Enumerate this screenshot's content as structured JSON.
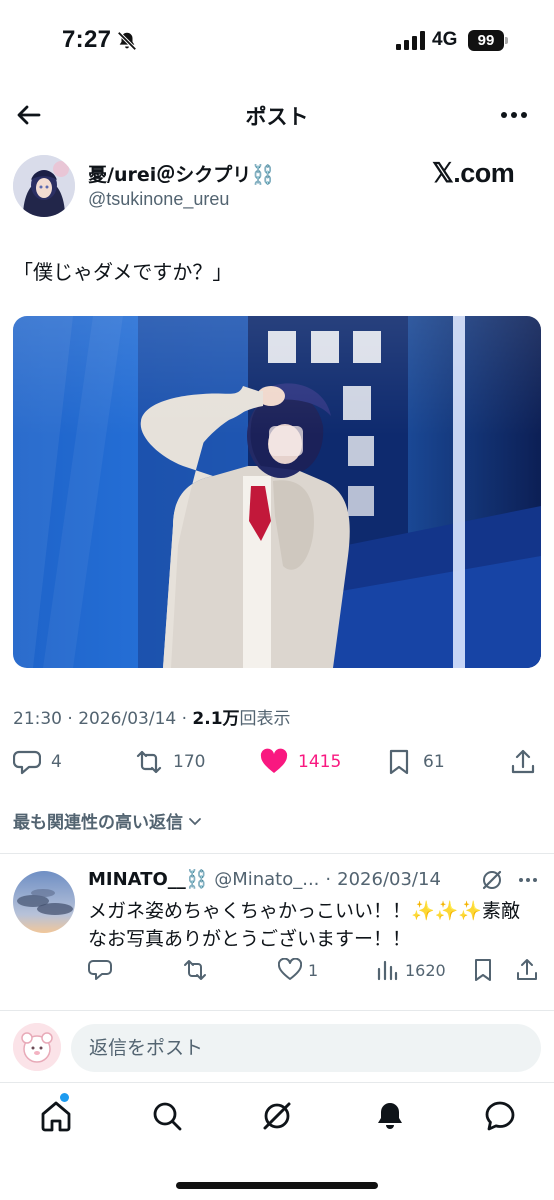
{
  "status_bar": {
    "time": "7:27",
    "network": "4G",
    "battery": "99"
  },
  "header": {
    "title": "ポスト"
  },
  "post": {
    "author_name": "憂/urei＠シクプリ⛓️",
    "author_handle": "@tsukinone_ureu",
    "source_logo": "𝕏.com",
    "text": "「僕じゃダメですか？」",
    "time": "21:30",
    "date": "2026/03/14",
    "views_count": "2.1万",
    "views_label": "回表示",
    "replies": "4",
    "reposts": "170",
    "likes": "1415",
    "bookmarks": "61",
    "like_color": "#f91880"
  },
  "relevance_label": "最も関連性の高い返信",
  "reply": {
    "name": "MINATO__⛓️",
    "handle": "@Minato_...",
    "date": "2026/03/14",
    "text": "メガネ姿めちゃくちゃかっこいい！！✨✨✨素敵なお写真ありがとうございますー！！",
    "likes": "1",
    "views": "1620"
  },
  "composer": {
    "placeholder": "返信をポスト"
  },
  "icons": {
    "back": "arrow-left-icon",
    "more": "more-horizontal-icon",
    "reply": "speech-bubble-icon",
    "repost": "repost-arrows-icon",
    "like": "heart-icon",
    "bookmark": "bookmark-icon",
    "share": "share-icon",
    "grok": "grok-icon",
    "views": "bar-chart-icon",
    "tabs": [
      "home-icon",
      "search-icon",
      "grok-icon",
      "bell-icon",
      "message-bubble-icon"
    ]
  },
  "colors": {
    "accent": "#1d9bf0",
    "text_secondary": "#536471"
  }
}
